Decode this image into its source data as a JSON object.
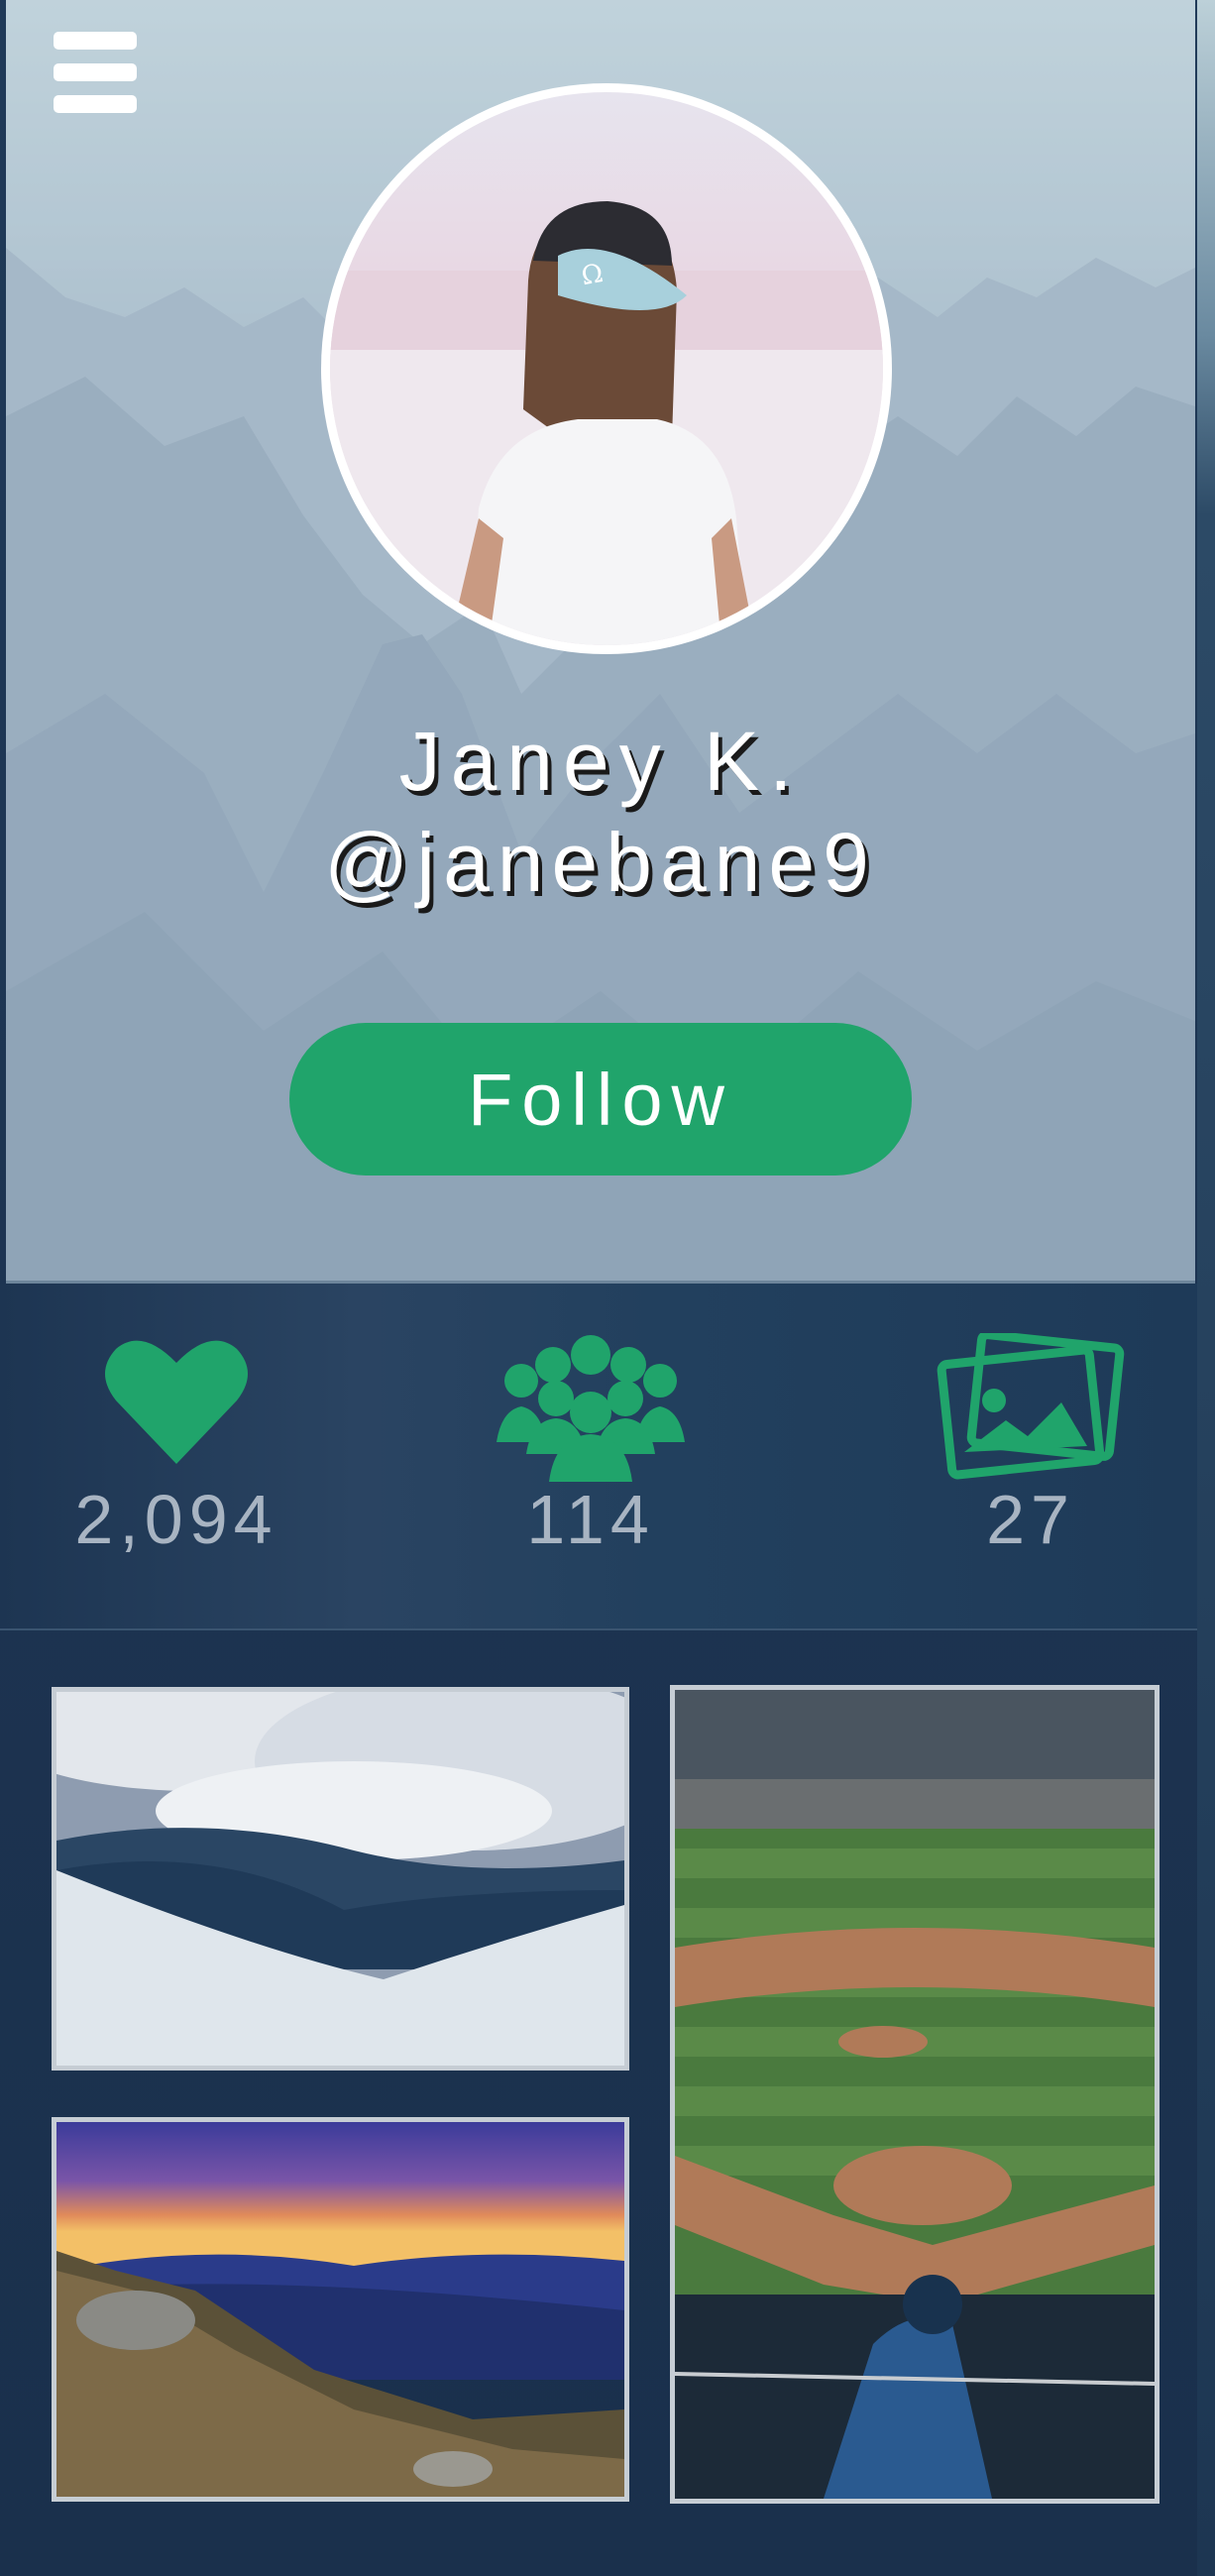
{
  "profile": {
    "name": "Janey K.",
    "handle": "@janebane9",
    "follow_label": "Follow"
  },
  "stats": {
    "likes": {
      "icon": "heart-icon",
      "value": "2,094"
    },
    "friends": {
      "icon": "group-icon",
      "value": "114"
    },
    "photos": {
      "icon": "photos-icon",
      "value": "27"
    }
  },
  "gallery": [
    {
      "name": "snowy-mountain-photo"
    },
    {
      "name": "mountain-sunset-photo"
    },
    {
      "name": "baseball-stadium-photo"
    }
  ],
  "colors": {
    "accent": "#20a46b",
    "background": "#1e3450",
    "stat_text": "#a8b4c2"
  }
}
